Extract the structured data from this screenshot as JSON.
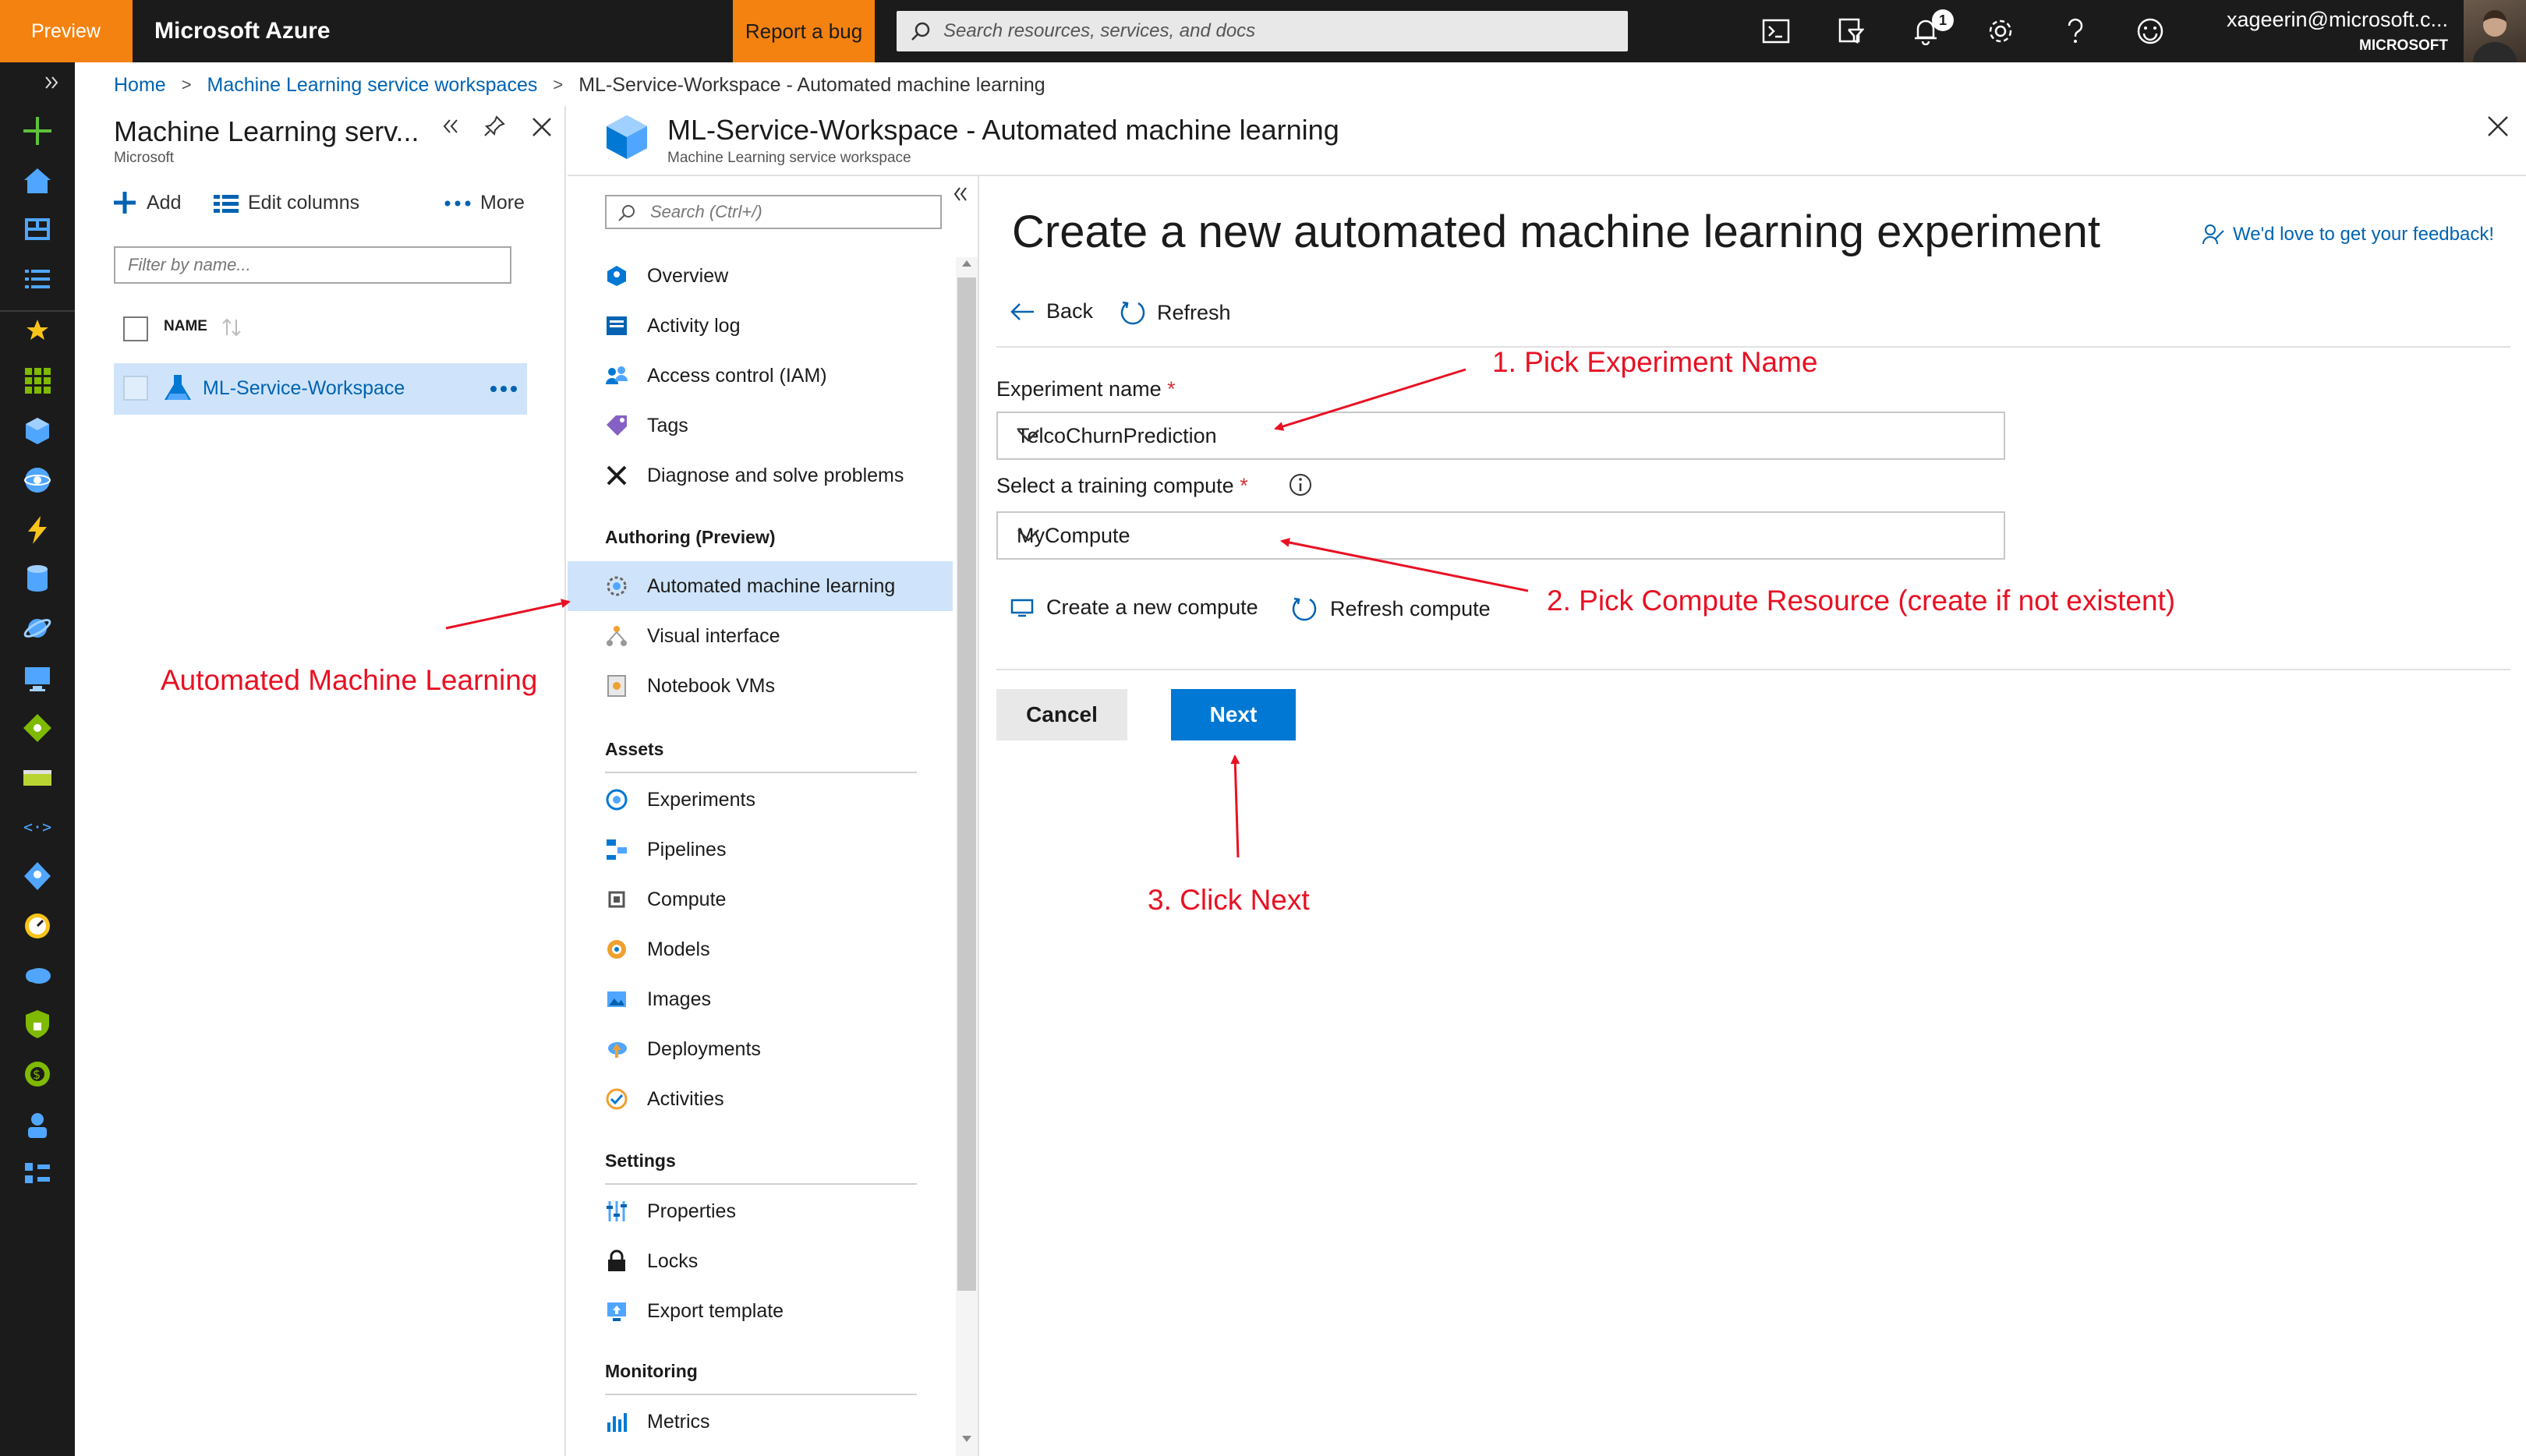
{
  "topbar": {
    "preview_label": "Preview",
    "brand": "Microsoft Azure",
    "report_bug": "Report a bug",
    "search_placeholder": "Search resources, services, and docs",
    "notification_count": "1",
    "user_email": "xageerin@microsoft.c...",
    "user_org": "MICROSOFT"
  },
  "breadcrumb": {
    "home": "Home",
    "workspaces": "Machine Learning service workspaces",
    "current": "ML-Service-Workspace - Automated machine learning"
  },
  "blade1": {
    "title": "Machine Learning serv...",
    "subtitle": "Microsoft",
    "add": "Add",
    "edit_columns": "Edit columns",
    "more": "More",
    "filter_placeholder": "Filter by name...",
    "column_name": "NAME",
    "workspace": "ML-Service-Workspace"
  },
  "blade2": {
    "title": "ML-Service-Workspace - Automated machine learning",
    "subtitle": "Machine Learning service workspace",
    "search_placeholder": "Search (Ctrl+/)",
    "menu": {
      "overview": "Overview",
      "activity_log": "Activity log",
      "access_control": "Access control (IAM)",
      "tags": "Tags",
      "diagnose": "Diagnose and solve problems",
      "authoring_header": "Authoring (Preview)",
      "automl": "Automated machine learning",
      "visual_interface": "Visual interface",
      "notebook_vms": "Notebook VMs",
      "assets_header": "Assets",
      "experiments": "Experiments",
      "pipelines": "Pipelines",
      "compute": "Compute",
      "models": "Models",
      "images": "Images",
      "deployments": "Deployments",
      "activities": "Activities",
      "settings_header": "Settings",
      "properties": "Properties",
      "locks": "Locks",
      "export_template": "Export template",
      "monitoring_header": "Monitoring",
      "metrics": "Metrics"
    }
  },
  "content": {
    "title": "Create a new automated machine learning experiment",
    "feedback": "We'd love to get your feedback!",
    "back": "Back",
    "refresh": "Refresh",
    "experiment_label": "Experiment name",
    "experiment_value": "TelcoChurnPrediction",
    "compute_label": "Select a training compute",
    "compute_value": "MyCompute",
    "required_mark": "*",
    "create_compute": "Create a new compute",
    "refresh_compute": "Refresh compute",
    "cancel": "Cancel",
    "next": "Next"
  },
  "annotations": {
    "step1": "1. Pick Experiment Name",
    "step2": "2. Pick Compute Resource (create if not existent)",
    "step3": "3. Click Next",
    "automl_note": "Automated Machine Learning",
    "color": "#e81123"
  }
}
